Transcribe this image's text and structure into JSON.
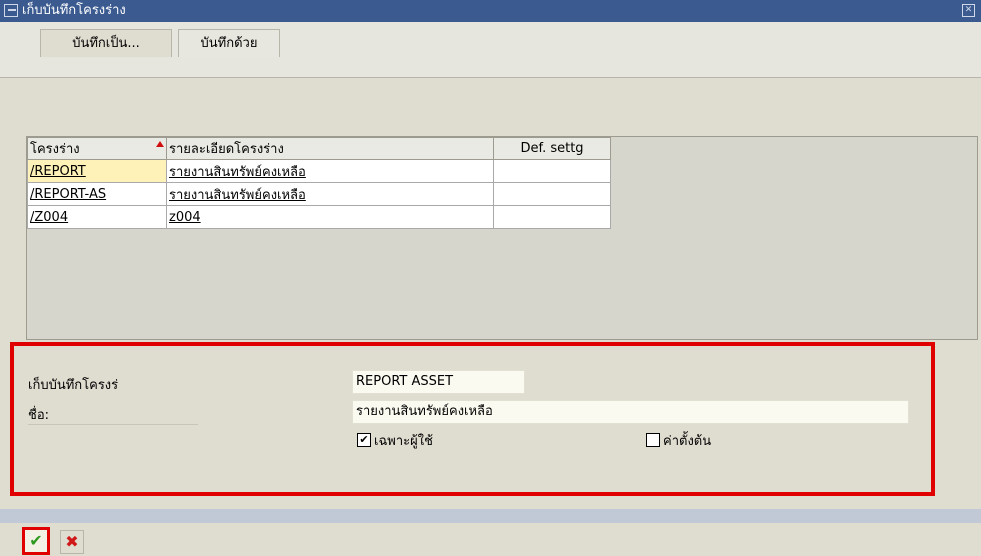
{
  "window": {
    "title": "เก็บบันทึกโครงร่าง"
  },
  "tabs": [
    {
      "label": "บันทึกเป็น..."
    },
    {
      "label": "บันทึกด้วย"
    }
  ],
  "grid": {
    "headers": [
      "โครงร่าง",
      "รายละเอียดโครงร่าง",
      "Def. settg"
    ],
    "rows": [
      {
        "layout": "/REPORT",
        "description": "รายงานสินทรัพย์คงเหลือ",
        "default": ""
      },
      {
        "layout": "/REPORT-AS",
        "description": "รายงานสินทรัพย์คงเหลือ",
        "default": ""
      },
      {
        "layout": "/Z004",
        "description": "z004",
        "default": ""
      }
    ]
  },
  "form": {
    "save_label": "เก็บบันทึกโครงร่",
    "save_value": "REPORT ASSET",
    "name_label": "ชื่อ:",
    "name_value": "รายงานสินทรัพย์คงเหลือ",
    "user_specific_label": "เฉพาะผู้ใช้",
    "user_specific_checked": true,
    "default_label": "ค่าตั้งต้น",
    "default_checked": false
  },
  "toolbar": {
    "confirm_icon": "✔",
    "cancel_icon": "✖"
  },
  "colors": {
    "titlebar": "#3a5a90",
    "highlight": "#e00000",
    "selected_cell": "#fff2b8"
  }
}
